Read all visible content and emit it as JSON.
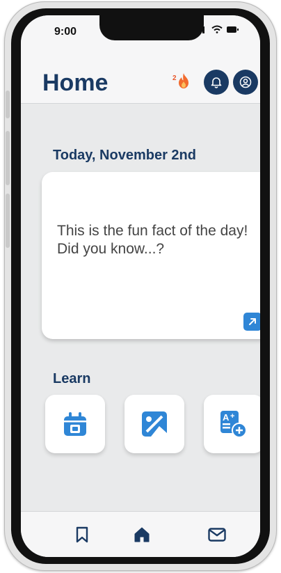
{
  "status_bar": {
    "time": "9:00"
  },
  "header": {
    "title": "Home",
    "streak_count": "2"
  },
  "today": {
    "date_label": "Today, November 2nd"
  },
  "fact_card": {
    "text": "This is the fun fact of the day! Did you know...?"
  },
  "learn": {
    "heading": "Learn",
    "tiles": [
      {
        "icon": "calendar-icon"
      },
      {
        "icon": "image-quiz-icon"
      },
      {
        "icon": "flashcards-icon"
      }
    ]
  },
  "bottom_nav": {
    "items": [
      {
        "icon": "bookmark-icon"
      },
      {
        "icon": "home-icon",
        "active": true
      },
      {
        "icon": "mail-icon"
      }
    ]
  },
  "colors": {
    "primary": "#1a3a63",
    "accent": "#2f86d6",
    "streak": "#f26b2e",
    "background": "#e9eaeb"
  }
}
